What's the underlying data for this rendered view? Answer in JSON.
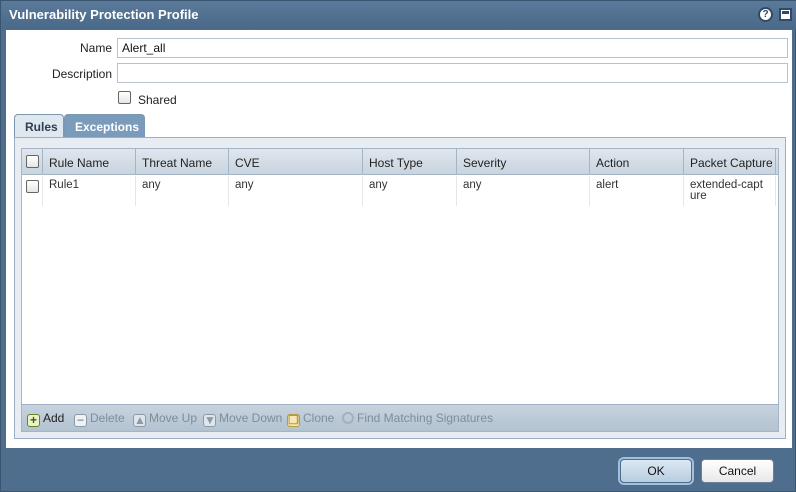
{
  "dialog": {
    "title": "Vulnerability Protection Profile",
    "help_glyph": "?"
  },
  "form": {
    "name_label": "Name",
    "name_value": "Alert_all",
    "description_label": "Description",
    "description_value": "",
    "shared_label": "Shared",
    "shared_checked": false
  },
  "tabs": [
    {
      "label": "Rules",
      "active": true
    },
    {
      "label": "Exceptions",
      "active": false
    }
  ],
  "table": {
    "columns": [
      "Rule Name",
      "Threat Name",
      "CVE",
      "Host Type",
      "Severity",
      "Action",
      "Packet Capture"
    ],
    "rows": [
      {
        "rule_name": "Rule1",
        "threat_name": "any",
        "cve": "any",
        "host_type": "any",
        "severity": "any",
        "action": "alert",
        "packet_capture": "extended-capture"
      }
    ]
  },
  "toolbar": {
    "add": "Add",
    "delete": "Delete",
    "move_up": "Move Up",
    "move_down": "Move Down",
    "clone": "Clone",
    "find": "Find Matching Signatures"
  },
  "footer": {
    "ok": "OK",
    "cancel": "Cancel"
  },
  "colors": {
    "titlebar": "#4f6e8e",
    "panel": "#e7edf3",
    "grid_header": "#c9d4df"
  },
  "icons": [
    "help-icon",
    "maximize-icon",
    "add-icon",
    "delete-icon",
    "move-up-icon",
    "move-down-icon",
    "clone-icon",
    "search-icon"
  ]
}
